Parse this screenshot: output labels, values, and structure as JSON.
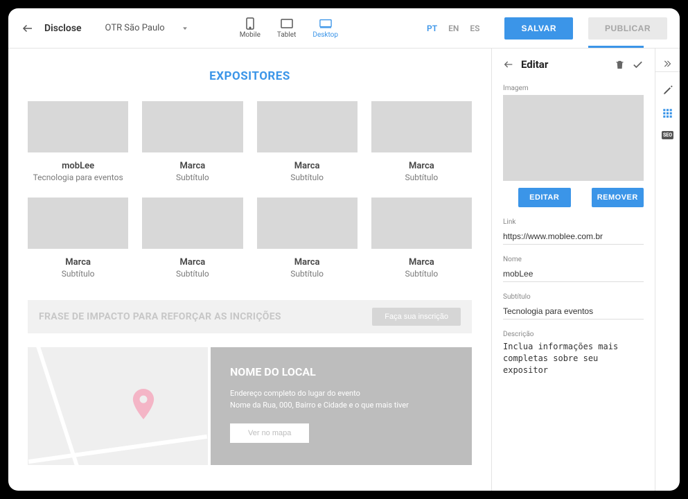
{
  "header": {
    "app_name": "Disclose",
    "event_name": "OTR São Paulo",
    "devices": {
      "mobile": "Mobile",
      "tablet": "Tablet",
      "desktop": "Desktop"
    },
    "langs": {
      "pt": "PT",
      "en": "EN",
      "es": "ES"
    },
    "save": "SALVAR",
    "publish": "PUBLICAR"
  },
  "main": {
    "section_title": "EXPOSITORES",
    "cards": [
      {
        "title": "mobLee",
        "sub": "Tecnologia para eventos"
      },
      {
        "title": "Marca",
        "sub": "Subtítulo"
      },
      {
        "title": "Marca",
        "sub": "Subtítulo"
      },
      {
        "title": "Marca",
        "sub": "Subtítulo"
      },
      {
        "title": "Marca",
        "sub": "Subtítulo"
      },
      {
        "title": "Marca",
        "sub": "Subtítulo"
      },
      {
        "title": "Marca",
        "sub": "Subtítulo"
      },
      {
        "title": "Marca",
        "sub": "Subtítulo"
      }
    ],
    "cta_text": "FRASE DE IMPACTO PARA REFORÇAR AS INCRIÇÕES",
    "cta_btn": "Faça sua inscrição",
    "loc_title": "NOME DO LOCAL",
    "loc_addr1": "Endereço completo do lugar do evento",
    "loc_addr2": "Nome da Rua, 000, Bairro e Cidade e o que mais tiver",
    "loc_btn": "Ver no mapa"
  },
  "side": {
    "title": "Editar",
    "img_label": "Imagem",
    "img_edit": "EDITAR",
    "img_remove": "REMOVER",
    "link_label": "Link",
    "link_value": "https://www.moblee.com.br",
    "name_label": "Nome",
    "name_value": "mobLee",
    "sub_label": "Subtítulo",
    "sub_value": "Tecnologia para eventos",
    "desc_label": "Descrição",
    "desc_value": "Inclua informações mais completas sobre seu expositor"
  },
  "rail": {
    "seo": "SEO"
  }
}
